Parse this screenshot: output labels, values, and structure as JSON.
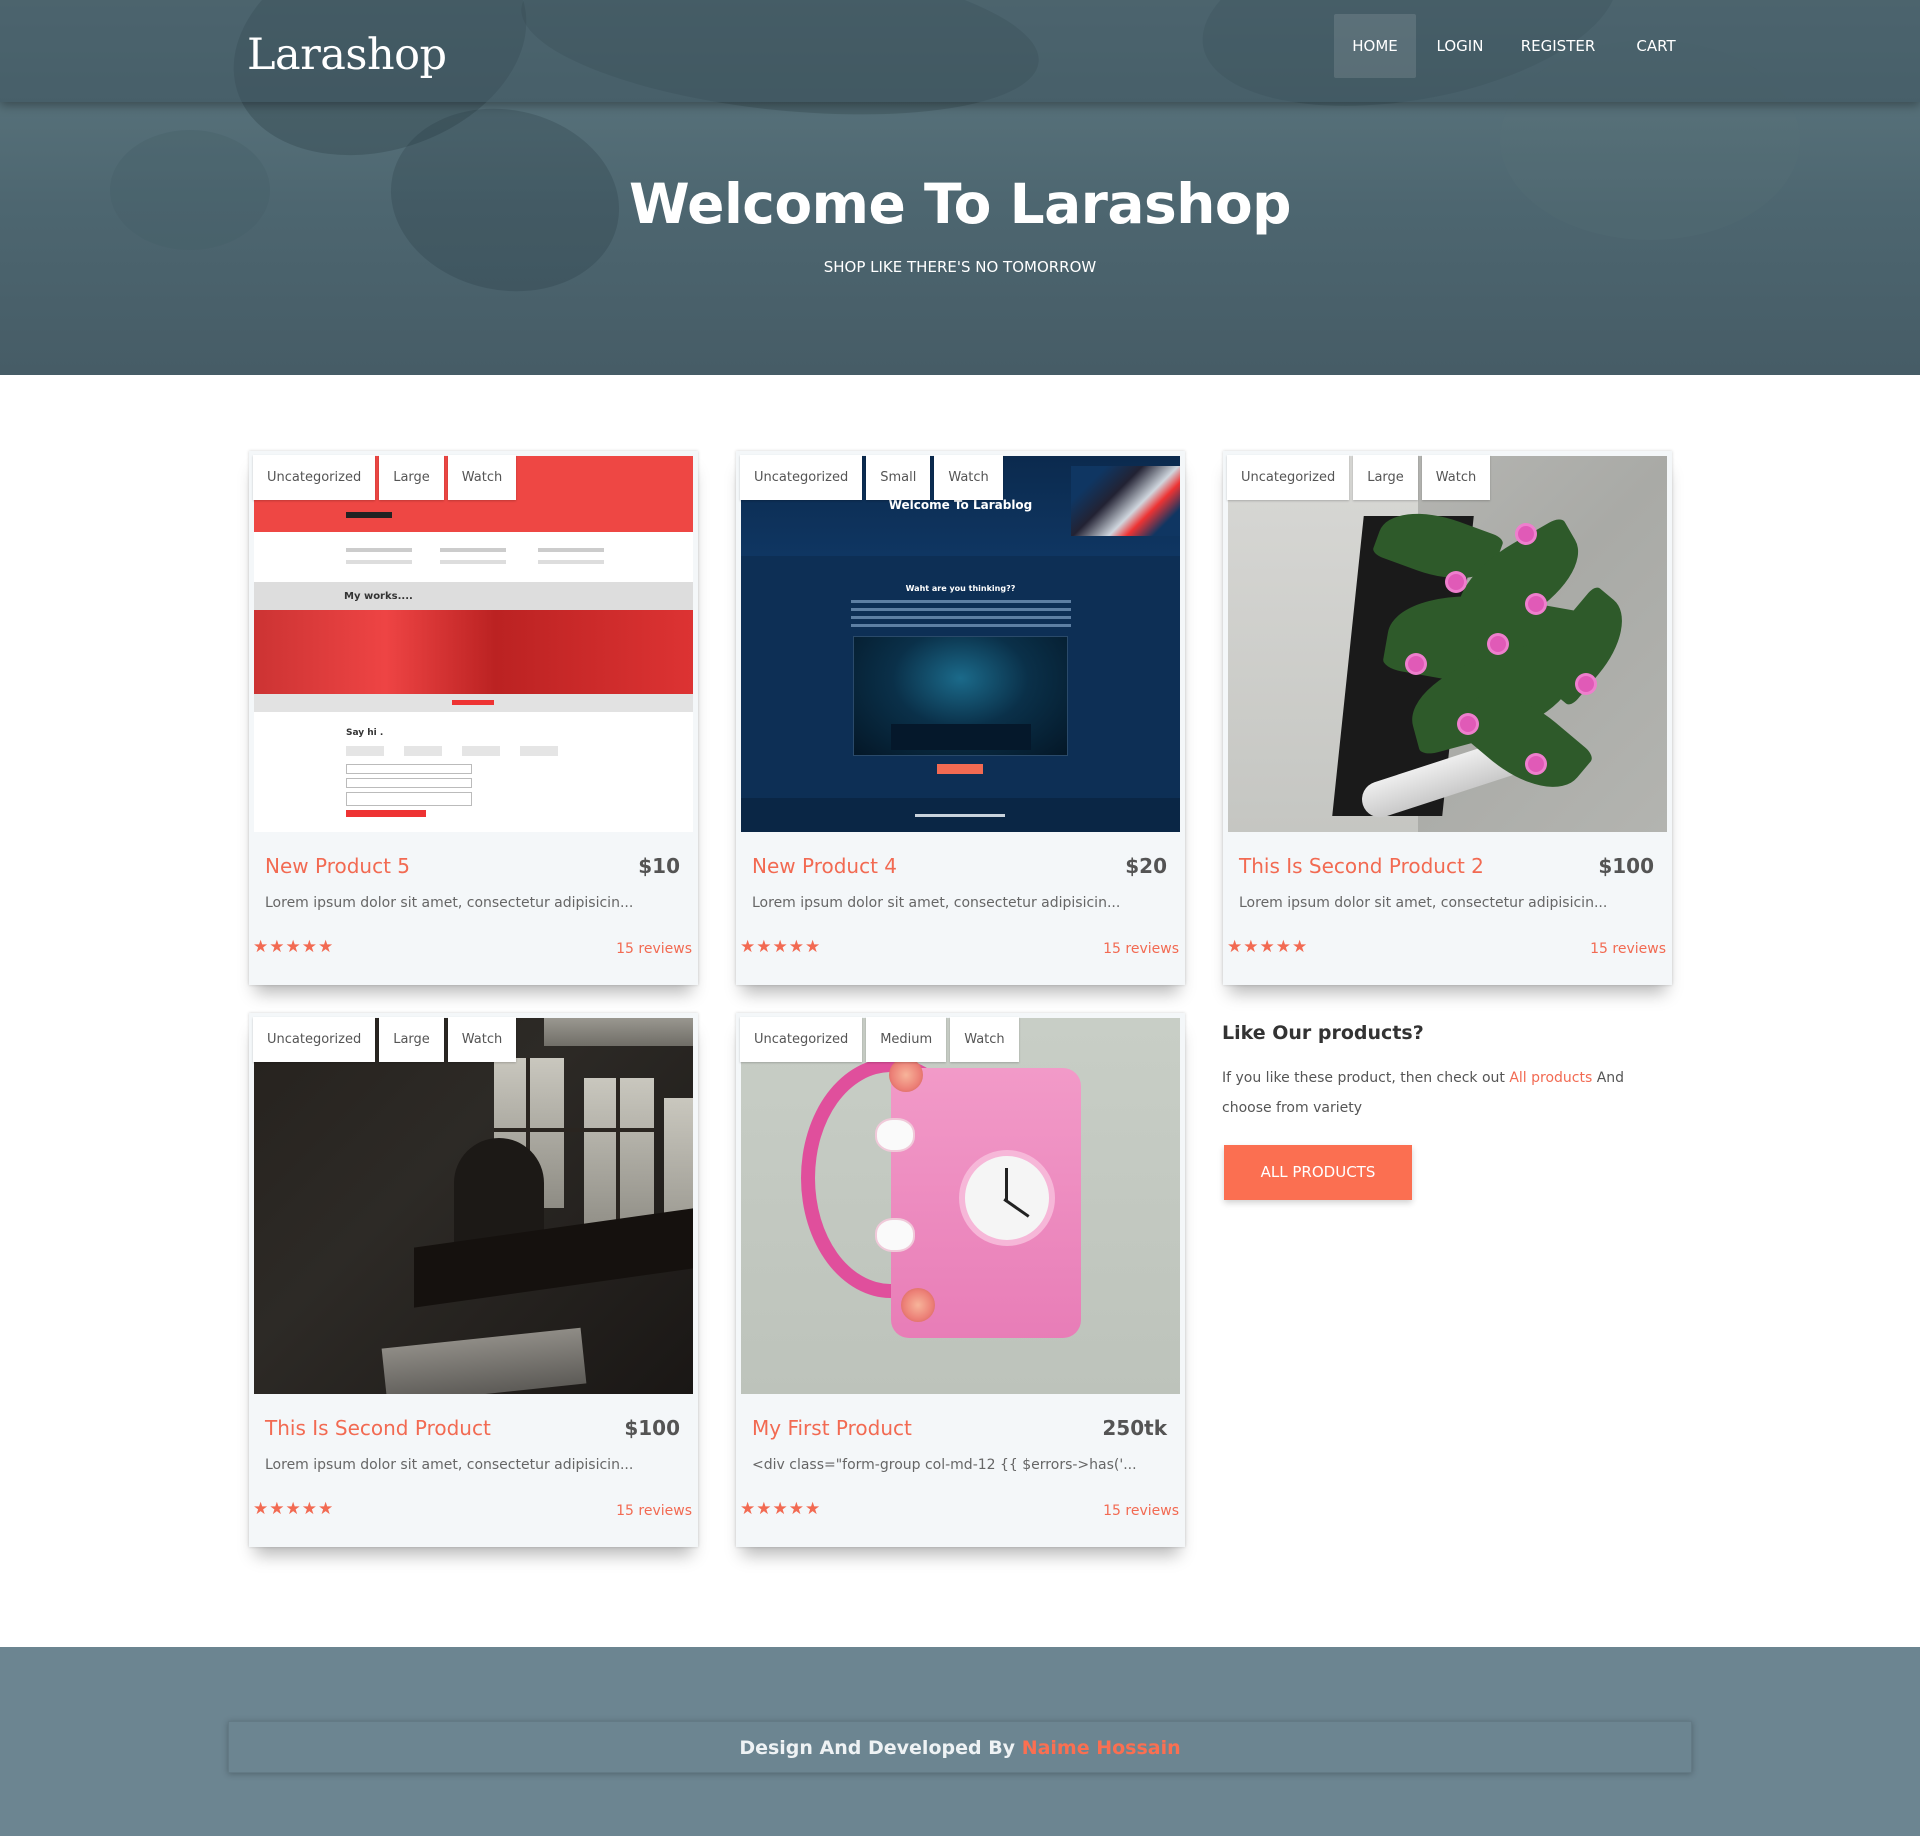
{
  "brand": "Larashop",
  "nav": [
    {
      "label": "HOME",
      "active": true
    },
    {
      "label": "LOGIN",
      "active": false
    },
    {
      "label": "REGISTER",
      "active": false
    },
    {
      "label": "CART",
      "active": false
    }
  ],
  "hero": {
    "title": "Welcome To Larashop",
    "subtitle": "SHOP LIKE THERE'S NO TOMORROW"
  },
  "products": [
    {
      "tags": [
        "Uncategorized",
        "Large",
        "Watch"
      ],
      "title": "New Product 5",
      "price": "$10",
      "description": "Lorem ipsum dolor sit amet, consectetur adipisicin...",
      "stars": "★★★★★",
      "reviews": "15 reviews",
      "image": "red-portfolio-screenshot",
      "image_text": [
        "My works....",
        "Say hi ."
      ]
    },
    {
      "tags": [
        "Uncategorized",
        "Small",
        "Watch"
      ],
      "title": "New Product 4",
      "price": "$20",
      "description": "Lorem ipsum dolor sit amet, consectetur adipisicin...",
      "stars": "★★★★★",
      "reviews": "15 reviews",
      "image": "larablog-screenshot",
      "image_text": [
        "Welcome To Larablog",
        "Waht are you thinking??"
      ]
    },
    {
      "tags": [
        "Uncategorized",
        "Large",
        "Watch"
      ],
      "title": "This Is Second Product 2",
      "price": "$100",
      "description": "Lorem ipsum dolor sit amet, consectetur adipisicin...",
      "stars": "★★★★★",
      "reviews": "15 reviews",
      "image": "pink-flower-plant-photo"
    },
    {
      "tags": [
        "Uncategorized",
        "Large",
        "Watch"
      ],
      "title": "This Is Second Product",
      "price": "$100",
      "description": "Lorem ipsum dolor sit amet, consectetur adipisicin...",
      "stars": "★★★★★",
      "reviews": "15 reviews",
      "image": "dark-classroom-photo"
    },
    {
      "tags": [
        "Uncategorized",
        "Medium",
        "Watch"
      ],
      "title": "My First Product",
      "price": "250tk",
      "description": "<div class=\"form-group col-md-12 {{ $errors->has('...",
      "stars": "★★★★★",
      "reviews": "15 reviews",
      "image": "pink-clock-basket-photo"
    }
  ],
  "sidebar": {
    "title": "Like Our products?",
    "text_before": "If you like these product, then check out ",
    "link": "All products",
    "text_after": " And choose from variety",
    "button": "ALL PRODUCTS"
  },
  "footer": {
    "text": "Design And Developed By ",
    "author": "Naime Hossain"
  },
  "colors": {
    "accent": "#f26a52",
    "button": "#fb6f51",
    "footer_bg": "#6c8591",
    "hero_bg": "#4d6670"
  }
}
